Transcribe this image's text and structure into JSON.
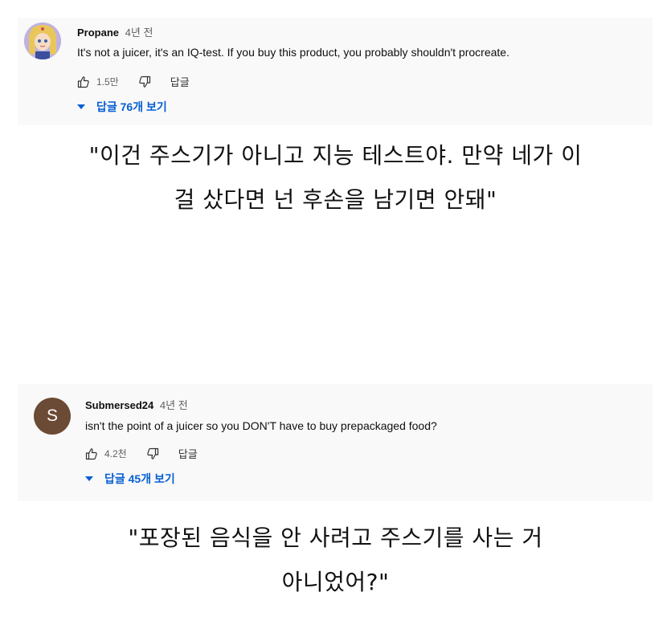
{
  "comments": [
    {
      "author": "Propane",
      "timestamp": "4년 전",
      "text": "It's not a juicer, it's an IQ-test. If you buy this product, you probably shouldn't procreate.",
      "like_count": "1.5만",
      "reply_label": "답글",
      "replies_label": "답글 76개 보기",
      "avatar_icon": "anime-character-avatar"
    },
    {
      "author": "Submersed24",
      "timestamp": "4년 전",
      "text": "isn't the point of a juicer so you DON'T have to buy prepackaged food?",
      "like_count": "4.2천",
      "reply_label": "답글",
      "replies_label": "답글 45개 보기",
      "avatar_letter": "S",
      "avatar_color": "#6b4a36"
    }
  ],
  "translations": [
    {
      "line1": "\"이건 주스기가 아니고 지능 테스트야. 만약 네가 이",
      "line2": "걸 샀다면 넌 후손을 남기면 안돼\""
    },
    {
      "line1": "\"포장된 음식을 안 사려고 주스기를 사는 거",
      "line2": "아니었어?\""
    }
  ],
  "colors": {
    "card_background": "#f9f9f9",
    "link_blue": "#065fd4",
    "secondary_text": "#606060"
  }
}
